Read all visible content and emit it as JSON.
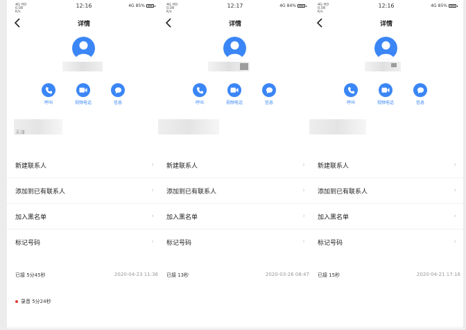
{
  "colors": {
    "accent": "#3b86f6",
    "record_dot": "#e53935"
  },
  "screens": [
    {
      "status": {
        "left": "4G HD 0.08 K/s",
        "time": "12:16",
        "signal": "4G",
        "battery": "85%"
      },
      "title": "详情",
      "actions": {
        "call": "呼叫",
        "video": "视频电话",
        "message": "信息"
      },
      "info_text": "天津",
      "menu": [
        "新建联系人",
        "添加到已有联系人",
        "加入黑名单",
        "标记号码"
      ],
      "call": {
        "duration": "已接 5分45秒",
        "date": "2020-04-23 11:36"
      },
      "recording": "录音 5分24秒"
    },
    {
      "status": {
        "left": "4G HD 0.08 K/s",
        "time": "12:17",
        "signal": "4G",
        "battery": "84%"
      },
      "title": "详情",
      "actions": {
        "call": "呼叫",
        "video": "视频电话",
        "message": "信息"
      },
      "info_text": "",
      "menu": [
        "新建联系人",
        "添加到已有联系人",
        "加入黑名单",
        "标记号码"
      ],
      "call": {
        "duration": "已接 13秒",
        "date": "2020-03-26 08:47"
      },
      "recording": ""
    },
    {
      "status": {
        "left": "4G HD 0.08 K/s",
        "time": "12:16",
        "signal": "4G",
        "battery": "85%"
      },
      "title": "详情",
      "actions": {
        "call": "呼叫",
        "video": "视频电话",
        "message": "信息"
      },
      "info_text": "",
      "menu": [
        "新建联系人",
        "添加到已有联系人",
        "加入黑名单",
        "标记号码"
      ],
      "call": {
        "duration": "已接 15秒",
        "date": "2020-04-21 17:16"
      },
      "recording": ""
    }
  ]
}
